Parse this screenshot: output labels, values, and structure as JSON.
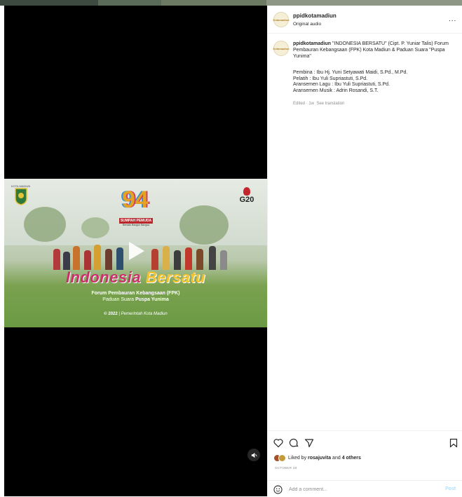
{
  "post": {
    "username": "ppidkotamadiun",
    "audio": "Original audio",
    "avatar_text": "Kotamadiun",
    "caption": "\"INDONESIA BERSATU\" (Cipt. P. Yuniar Talis) Forum Pembauran Kebangsaan (FPK) Kota Madiun & Paduan Suara \"Puspa Yunima\"",
    "credits": [
      "Pembina : Ibu Hj. Yuni Setyawati Maidi, S.Pd., M.Pd.",
      "Pelatih : Ibu Yuli Supriastuti, S.Pd.",
      "Aransemen Lagu : Ibu Yuli Supriastuti, S.Pd.",
      "Aransemen Musik : Adrin Rosandi, S.T."
    ],
    "edited": "Edited · 1w",
    "see_translation": "See translation",
    "liked_prefix": "Liked by ",
    "liked_user": "rosajuvita",
    "liked_mid": " and ",
    "liked_others": "4 others",
    "date": "OCTOBER 28",
    "comment_placeholder": "Add a comment...",
    "post_label": "Post",
    "more_label": "..."
  },
  "video": {
    "badge": "94",
    "sumpah": "SUMPAH PEMUDA",
    "sumpah_sub": "Bersatu Bangun Bangsa",
    "title_word1": "Indonesia",
    "title_word2": "Bersatu",
    "subtitle1": "Forum Pembauran Kebangsaan (FPK)",
    "subtitle2_prefix": "Paduan Suara ",
    "subtitle2_bold": "Puspa Yunima",
    "copyright_year": "© 2022",
    "copyright_sep": " | ",
    "copyright_owner": "Pemerintah Kota Madiun",
    "left_logo_caption": "KOTA MADIUN",
    "g20": "G20"
  },
  "colors": {
    "title_pink": "#c9316b",
    "title_yellow": "#f2c230",
    "green": "#6b9a44"
  }
}
